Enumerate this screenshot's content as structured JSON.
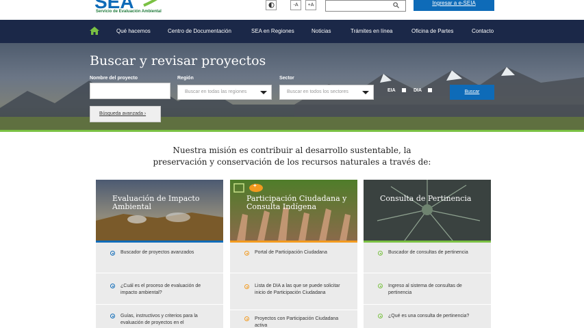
{
  "header": {
    "logo_text": "SEA",
    "logo_subtitle": "Servicio de Evaluación Ambiental",
    "contrast_icon": "contrast-icon",
    "font_decrease_label": "-A",
    "font_increase_label": "+A",
    "search_placeholder": "",
    "search_icon": "search-icon",
    "eseia_label": "Ingresar a e-SEIA"
  },
  "nav": {
    "home_icon": "home-icon",
    "items": [
      "Qué hacemos",
      "Centro de Documentación",
      "SEA en Regiones",
      "Noticias",
      "Trámites en línea",
      "Oficina de Partes",
      "Contacto"
    ]
  },
  "hero": {
    "title": "Buscar y revisar proyectos",
    "name_label": "Nombre del proyecto",
    "name_value": "",
    "region_label": "Región",
    "region_value": "Buscar en todas las regiones",
    "sector_label": "Sector",
    "sector_value": "Buscar en todos los sectores",
    "eia_label": "EIA",
    "dia_label": "DIA",
    "search_button": "Buscar",
    "advanced_button": "Búsqueda avanzada ›"
  },
  "mission": {
    "line1": "Nuestra misión es contribuir al desarrollo sustentable, la",
    "line2": "preservación y conservación de los recursos naturales a través de:"
  },
  "cards": [
    {
      "title": "Evaluación de Impacto Ambiental",
      "accent": "#0e6bb8",
      "links": [
        "Buscador de proyectos avanzados",
        "¿Cuál es el proceso de evaluación de impacto ambiental?",
        "Guías, instructivos y criterios para la evaluación de proyectos en el"
      ]
    },
    {
      "title": "Participación Ciudadana y Consulta Indígena",
      "accent": "#f29a1f",
      "badge": "+",
      "links": [
        "Portal de Participación Ciudadana",
        "Lista de DIA a las que se puede solicitar inicio de Participación Ciudadana",
        "Proyectos con Participación Ciudadana activa"
      ]
    },
    {
      "title": "Consulta de Pertinencia",
      "accent": "#7ac143",
      "links": [
        "Buscador de consultas de pertinencia",
        "Ingreso al sistema de consultas de pertinencia",
        "¿Qué es una consulta de pertinencia?"
      ]
    }
  ],
  "colors": {
    "nav_bg": "#1b2848",
    "primary_blue": "#0e6bb8",
    "green": "#7ac143",
    "orange": "#f29a1f"
  }
}
